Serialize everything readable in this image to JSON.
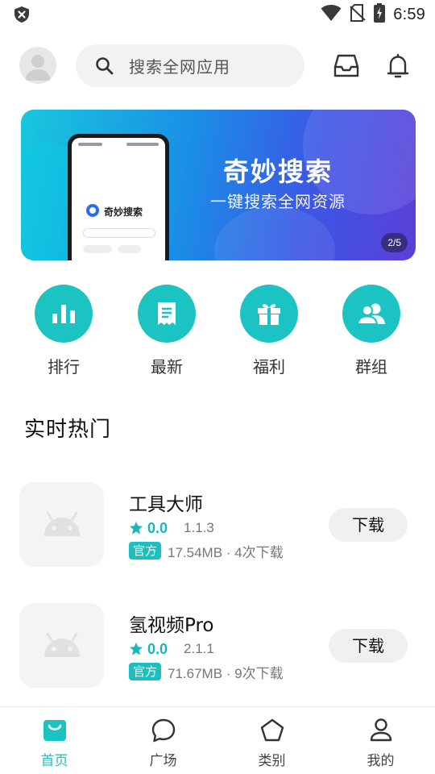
{
  "status_bar": {
    "time": "6:59",
    "left_icon": "shield-x-icon",
    "right_icons": [
      "wifi-icon",
      "no-sim-icon",
      "battery-charging-icon"
    ]
  },
  "header": {
    "avatar_icon": "default-avatar-icon",
    "search": {
      "placeholder": "搜索全网应用",
      "icon": "search-icon"
    },
    "inbox_icon": "inbox-icon",
    "bell_icon": "bell-icon"
  },
  "banner": {
    "title": "奇妙搜索",
    "subtitle": "一键搜索全网资源",
    "page_indicator": "2/5",
    "phone_app_name": "奇妙搜索"
  },
  "quick_entries": [
    {
      "label": "排行",
      "icon": "bar-chart-icon"
    },
    {
      "label": "最新",
      "icon": "receipt-icon"
    },
    {
      "label": "福利",
      "icon": "gift-icon"
    },
    {
      "label": "群组",
      "icon": "group-icon"
    }
  ],
  "section": {
    "title": "实时热门"
  },
  "apps": [
    {
      "name": "工具大师",
      "rating": "0.0",
      "version": "1.1.3",
      "badge": "官方",
      "meta": "17.54MB · 4次下载",
      "button": "下载",
      "icon": "android-icon"
    },
    {
      "name": "氢视频Pro",
      "rating": "0.0",
      "version": "2.1.1",
      "badge": "官方",
      "meta": "71.67MB · 9次下载",
      "button": "下载",
      "icon": "android-icon"
    }
  ],
  "bottom_nav": [
    {
      "label": "首页",
      "icon": "home-bag-icon",
      "active": true
    },
    {
      "label": "广场",
      "icon": "chat-bubble-icon",
      "active": false
    },
    {
      "label": "类别",
      "icon": "pentagon-icon",
      "active": false
    },
    {
      "label": "我的",
      "icon": "person-icon",
      "active": false
    }
  ],
  "colors": {
    "accent": "#1cc3c3",
    "rating": "#17b8bc",
    "badge": "#1cbfc0"
  }
}
